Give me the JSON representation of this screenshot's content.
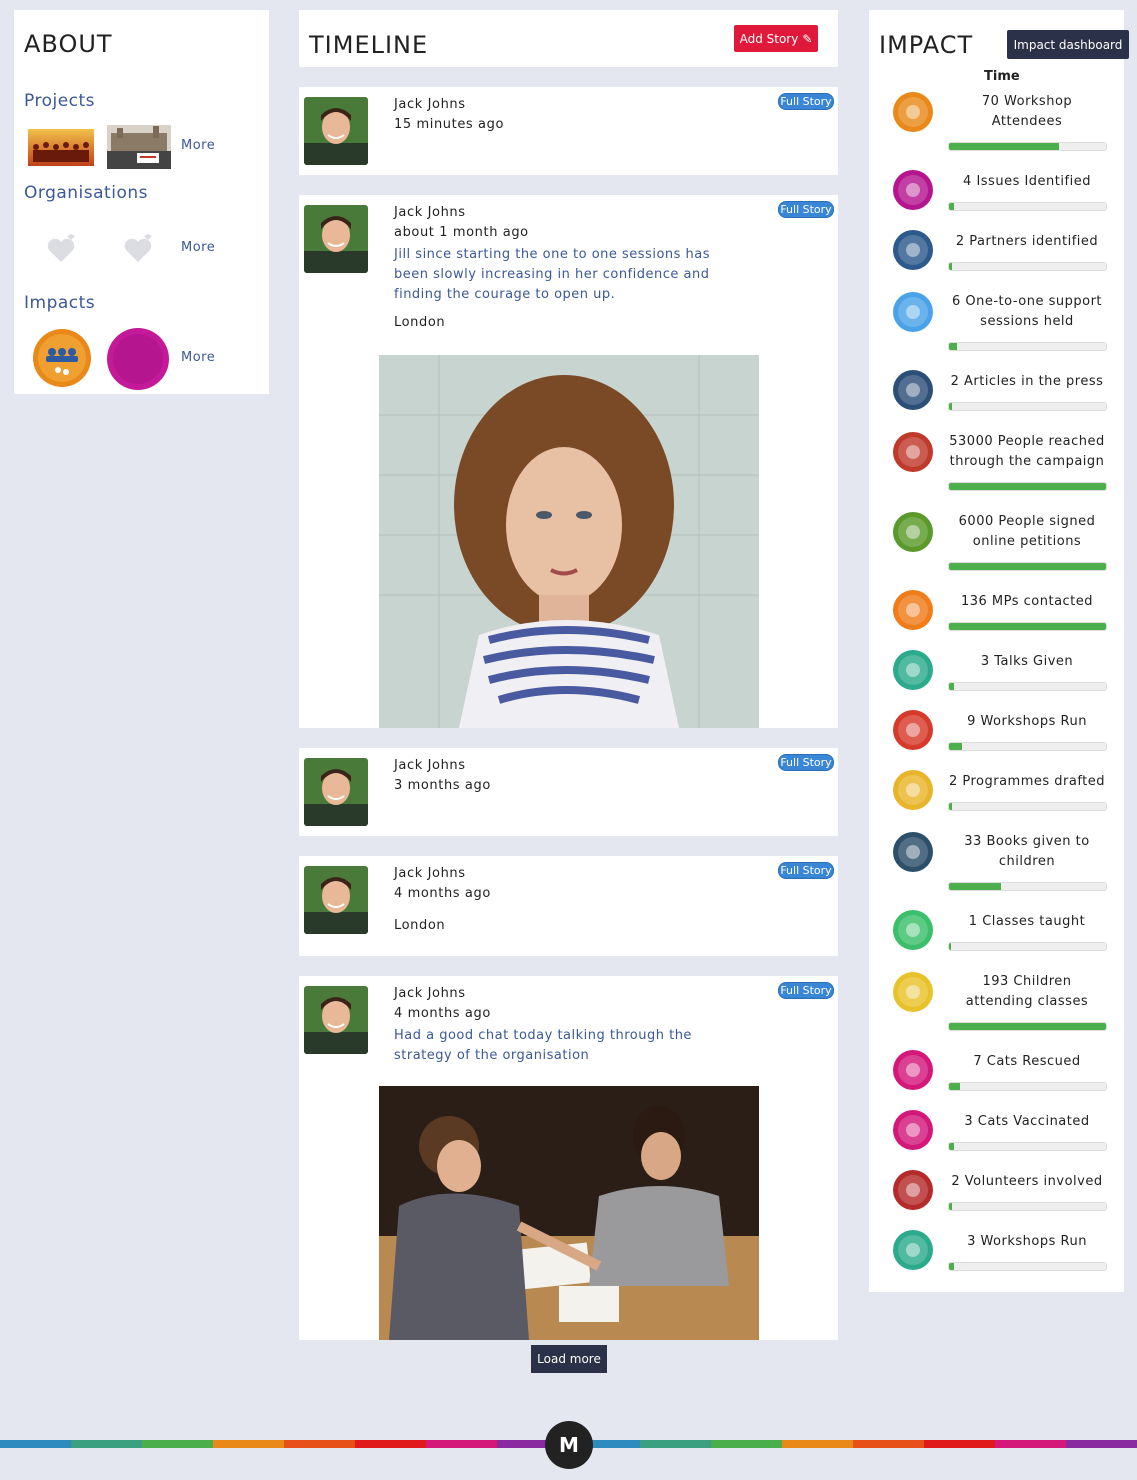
{
  "about": {
    "title": "ABOUT",
    "projects_label": "Projects",
    "organisations_label": "Organisations",
    "impacts_label": "Impacts",
    "more": "More"
  },
  "timeline": {
    "title": "TIMELINE",
    "add_story": "Add Story",
    "full_story": "Full Story",
    "load_more": "Load more",
    "stories": [
      {
        "author": "Jack Johns",
        "time": "15 minutes ago"
      },
      {
        "author": "Jack Johns",
        "time": "about 1 month ago",
        "text": "Jill since starting the one to one sessions has been slowly increasing in her confidence and finding the courage to open up.",
        "location": "London"
      },
      {
        "author": "Jack Johns",
        "time": "3 months ago"
      },
      {
        "author": "Jack Johns",
        "time": "4 months ago",
        "location": "London"
      },
      {
        "author": "Jack Johns",
        "time": "4 months ago",
        "text": "Had a good chat today talking through the strategy of the organisation"
      }
    ]
  },
  "impact": {
    "title": "IMPACT",
    "dashboard_button": "Impact dashboard",
    "time_label": "Time",
    "items": [
      {
        "label": "70 Workshop Attendees",
        "progress": 0.7,
        "color": "#e8891a",
        "icon": "workshop-attendees-icon"
      },
      {
        "label": "4 Issues Identified",
        "progress": 0.03,
        "color": "#b5168f",
        "icon": "issues-icon"
      },
      {
        "label": "2 Partners identified",
        "progress": 0.02,
        "color": "#2d5a8c",
        "icon": "partners-icon"
      },
      {
        "label": "6 One-to-one support sessions held",
        "progress": 0.05,
        "color": "#4aa3e8",
        "icon": "handshake-icon"
      },
      {
        "label": "2 Articles in the press",
        "progress": 0.02,
        "color": "#2c4f78",
        "icon": "press-icon"
      },
      {
        "label": "53000 People reached through the campaign",
        "progress": 1.0,
        "color": "#c0392b",
        "icon": "people-reached-icon"
      },
      {
        "label": "6000 People signed online petitions",
        "progress": 1.0,
        "color": "#5a9a2a",
        "icon": "petition-icon"
      },
      {
        "label": "136 MPs contacted",
        "progress": 1.0,
        "color": "#f07c1a",
        "icon": "mps-icon"
      },
      {
        "label": "3 Talks Given",
        "progress": 0.03,
        "color": "#2bab8c",
        "icon": "talks-icon"
      },
      {
        "label": "9 Workshops Run",
        "progress": 0.08,
        "color": "#d63a2a",
        "icon": "workshops-icon"
      },
      {
        "label": "2 Programmes drafted",
        "progress": 0.02,
        "color": "#e8b52a",
        "icon": "pencil-icon"
      },
      {
        "label": "33 Books given to children",
        "progress": 0.33,
        "color": "#2c4f6a",
        "icon": "books-icon"
      },
      {
        "label": "1 Classes taught",
        "progress": 0.01,
        "color": "#3bbf6a",
        "icon": "classes-icon"
      },
      {
        "label": "193 Children attending classes",
        "progress": 1.0,
        "color": "#e8c22a",
        "icon": "children-icon"
      },
      {
        "label": "7 Cats Rescued",
        "progress": 0.07,
        "color": "#d4187a",
        "icon": "cat-icon"
      },
      {
        "label": "3 Cats Vaccinated",
        "progress": 0.03,
        "color": "#d4187a",
        "icon": "cat-vaccinated-icon"
      },
      {
        "label": "2 Volunteers involved",
        "progress": 0.02,
        "color": "#b52a2a",
        "icon": "volunteers-icon"
      },
      {
        "label": "3 Workshops Run",
        "progress": 0.03,
        "color": "#2bab8c",
        "icon": "presentation-icon"
      }
    ]
  },
  "footer": {
    "logo": "M"
  }
}
